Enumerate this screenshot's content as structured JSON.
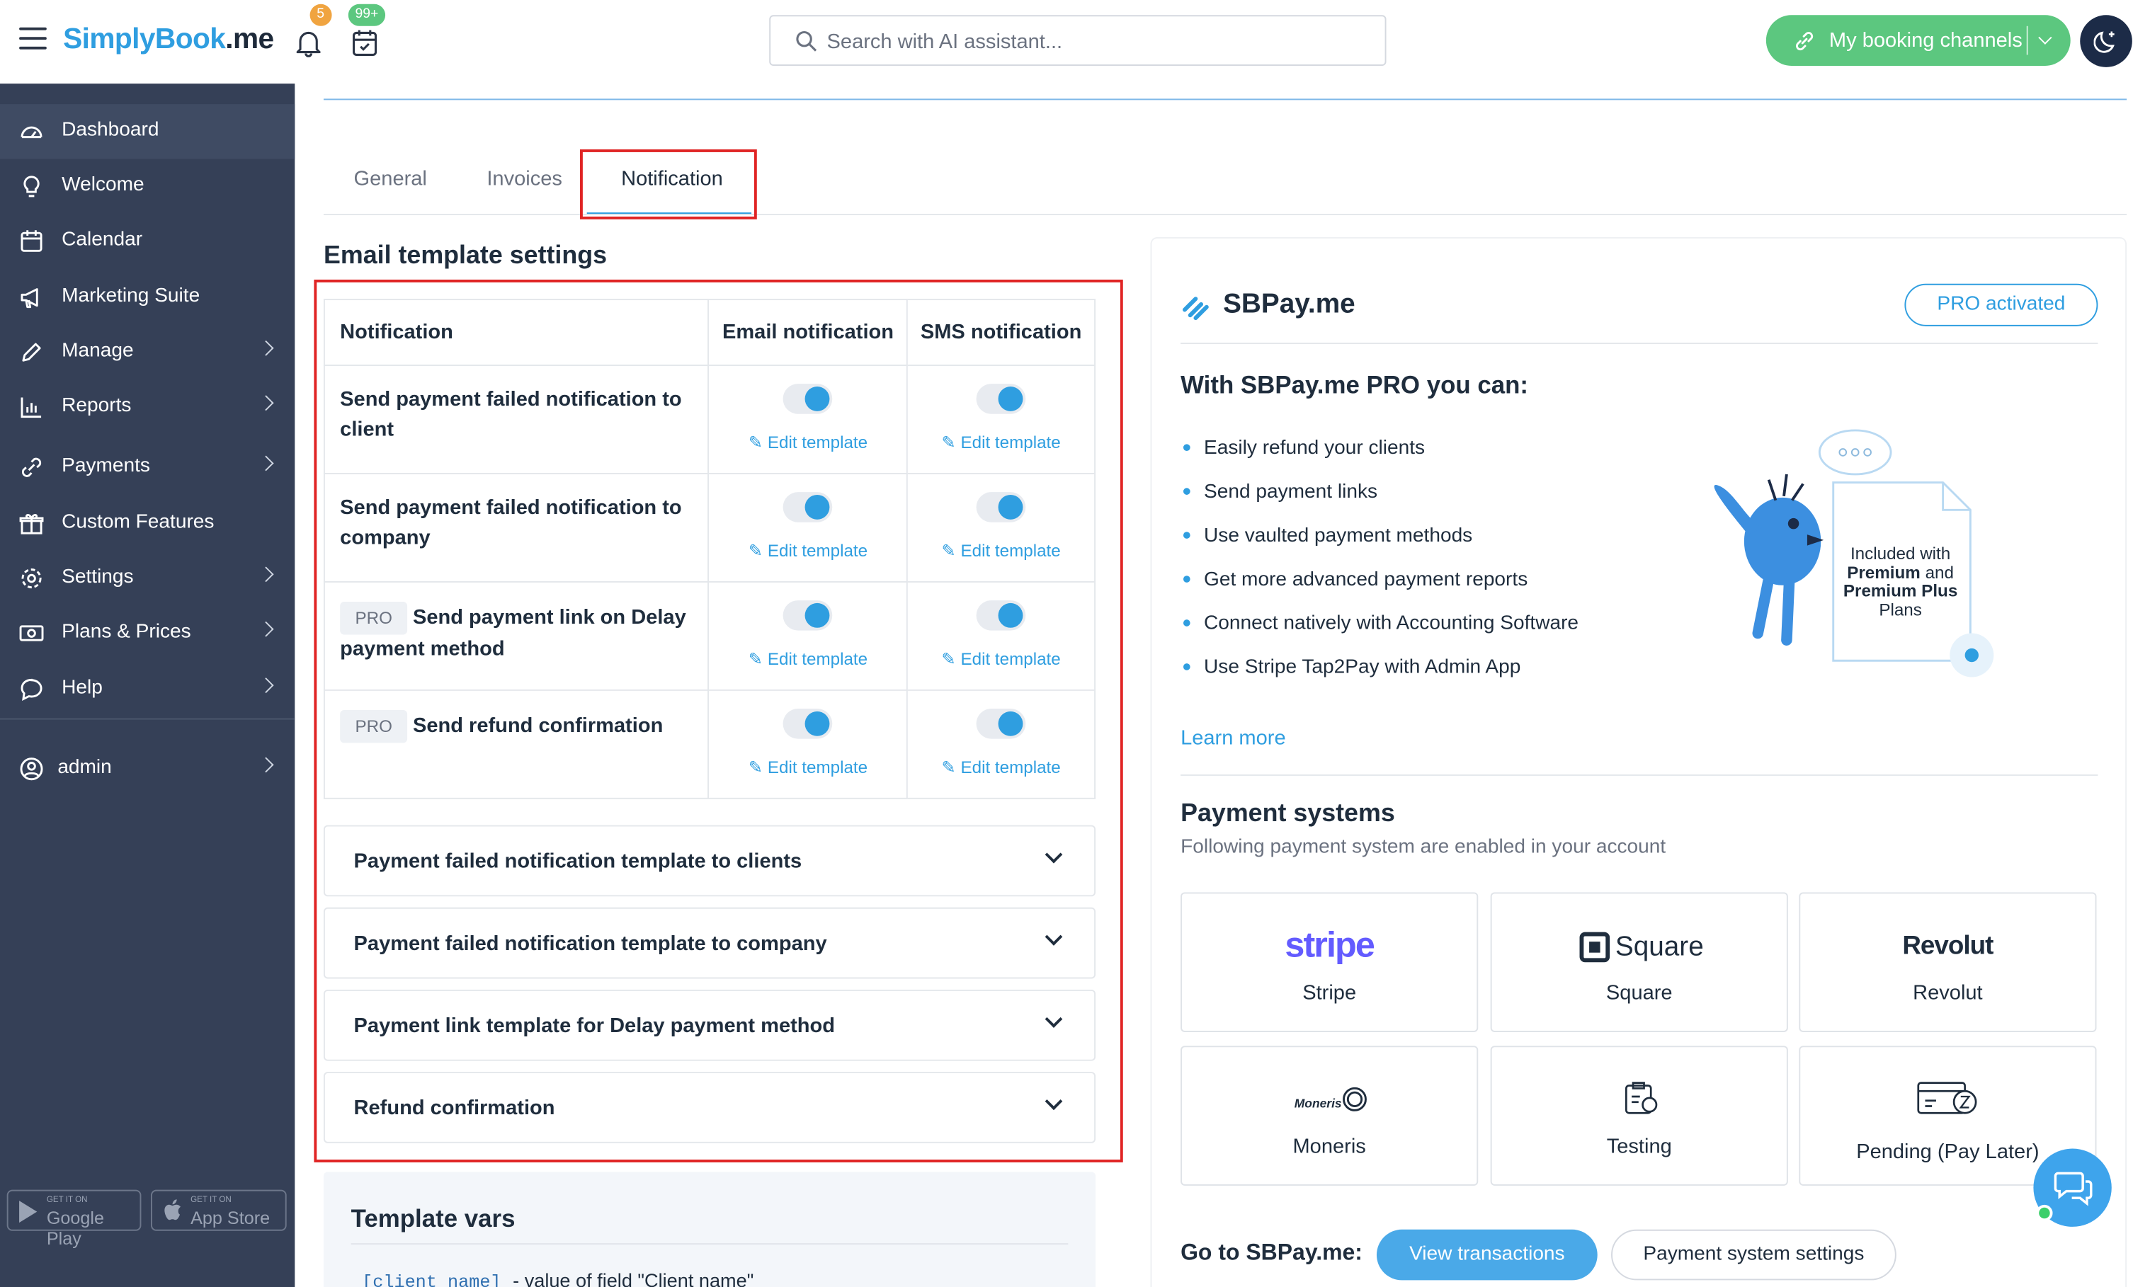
{
  "header": {
    "logo_first": "S",
    "logo_mid": "implyBook",
    "logo_end": ".me",
    "bell_count": "5",
    "calendar_count": "99+",
    "search_placeholder": "Search with AI assistant...",
    "booking_channels_label": "My booking channels"
  },
  "sidebar": {
    "items": [
      {
        "label": "Dashboard",
        "icon": "dashboard-icon"
      },
      {
        "label": "Welcome",
        "icon": "lightbulb-icon"
      },
      {
        "label": "Calendar",
        "icon": "calendar-icon"
      },
      {
        "label": "Marketing Suite",
        "icon": "megaphone-icon"
      },
      {
        "label": "Manage",
        "icon": "pencil-icon"
      },
      {
        "label": "Reports",
        "icon": "chart-icon"
      },
      {
        "label": "Payments",
        "icon": "payments-icon"
      },
      {
        "label": "Custom Features",
        "icon": "gift-icon"
      },
      {
        "label": "Settings",
        "icon": "gear-icon"
      },
      {
        "label": "Plans & Prices",
        "icon": "money-icon"
      },
      {
        "label": "Help",
        "icon": "chat-bubble-icon"
      }
    ],
    "user": "admin",
    "google_play_small": "GET IT ON",
    "google_play": "Google Play",
    "app_store_small": "GET IT ON",
    "app_store": "App Store"
  },
  "tabs": [
    "General",
    "Invoices",
    "Notification"
  ],
  "email_settings": {
    "title": "Email template settings",
    "columns": [
      "Notification",
      "Email notification",
      "SMS notification"
    ],
    "edit_label": "Edit template",
    "pro_label": "PRO",
    "rows": [
      {
        "name": "Send payment failed notification to client",
        "pro": false,
        "email_on": true,
        "sms_on": true
      },
      {
        "name": "Send payment failed notification to company",
        "pro": false,
        "email_on": true,
        "sms_on": true
      },
      {
        "name": "Send payment link on Delay payment method",
        "pro": true,
        "email_on": true,
        "sms_on": true
      },
      {
        "name": "Send refund confirmation",
        "pro": true,
        "email_on": true,
        "sms_on": true
      }
    ],
    "accordions": [
      "Payment failed notification template to clients",
      "Payment failed notification template to company",
      "Payment link template for Delay payment method",
      "Refund confirmation"
    ]
  },
  "template_vars": {
    "title": "Template vars",
    "code": "[client_name]",
    "desc": "- value of field \"Client name\""
  },
  "sbpay": {
    "title": "SBPay.me",
    "pro_button": "PRO activated",
    "with_title": "With SBPay.me PRO you can:",
    "bullets": [
      "Easily refund your clients",
      "Send payment links",
      "Use vaulted payment methods",
      "Get more advanced payment reports",
      "Connect natively with Accounting Software",
      "Use Stripe Tap2Pay with Admin App"
    ],
    "included_1": "Included with",
    "included_2": "Premium",
    "included_3": "and",
    "included_4": "Premium Plus",
    "included_5": "Plans",
    "learn_more": "Learn more",
    "systems_title": "Payment systems",
    "systems_sub": "Following payment system are enabled in your account",
    "systems": [
      {
        "logo": "stripe",
        "name": "Stripe"
      },
      {
        "logo": "Square",
        "name": "Square"
      },
      {
        "logo": "Revolut",
        "name": "Revolut"
      },
      {
        "logo": "Moneris",
        "name": "Moneris"
      },
      {
        "logo": "",
        "name": "Testing"
      },
      {
        "logo": "",
        "name": "Pending (Pay Later)"
      }
    ],
    "go_label": "Go to SBPay.me:",
    "view_transactions": "View transactions",
    "system_settings": "Payment system settings"
  },
  "colors": {
    "accent": "#2f9ee0",
    "sidebar": "#354057",
    "green": "#5cc77f",
    "highlight": "#e02424"
  }
}
